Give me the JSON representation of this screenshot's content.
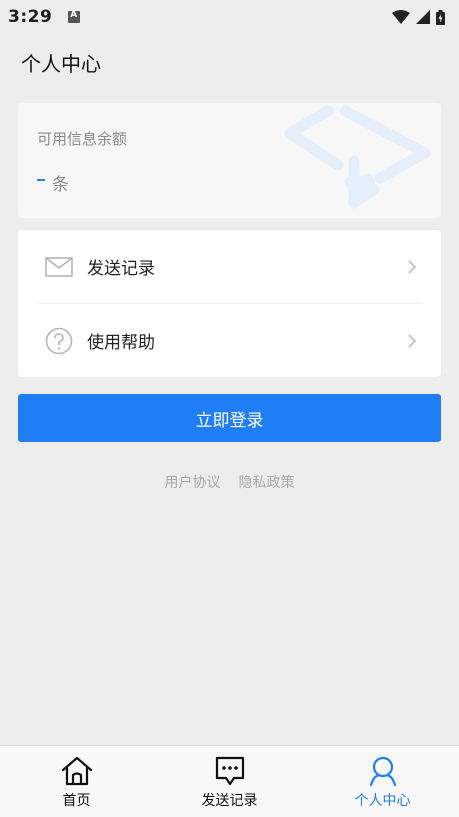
{
  "status_bar": {
    "time": "3:29"
  },
  "header": {
    "title": "个人中心"
  },
  "balance_card": {
    "label": "可用信息余额",
    "unit": "条"
  },
  "menu": {
    "items": [
      {
        "label": "发送记录",
        "icon": "mail-icon"
      },
      {
        "label": "使用帮助",
        "icon": "help-icon"
      }
    ]
  },
  "login_button": {
    "label": "立即登录"
  },
  "links": {
    "user_agreement": "用户协议",
    "privacy_policy": "隐私政策"
  },
  "bottom_nav": {
    "items": [
      {
        "label": "首页",
        "icon": "home-icon"
      },
      {
        "label": "发送记录",
        "icon": "chat-icon"
      },
      {
        "label": "个人中心",
        "icon": "user-icon",
        "active": true
      }
    ]
  },
  "colors": {
    "accent": "#1f7ef5",
    "background": "#ededed",
    "card": "#f7f7f7",
    "muted_text": "#8a8a8a"
  }
}
